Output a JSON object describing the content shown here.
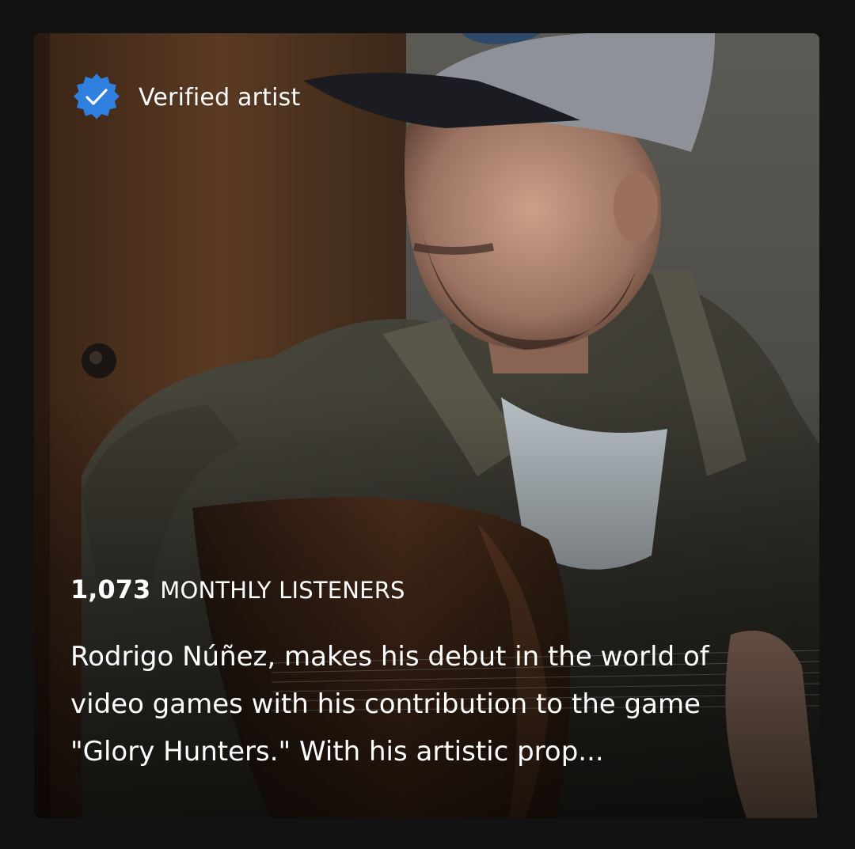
{
  "badge": {
    "icon": "verified-check-icon",
    "label": "Verified artist",
    "color": "#2f7fde"
  },
  "stats": {
    "count": "1,073",
    "unit": "MONTHLY LISTENERS"
  },
  "bio": {
    "text": "Rodrigo Núñez, makes his debut in the world of video games with his contribution to the game \"Glory Hunters.\" With his artistic prop..."
  },
  "image": {
    "description_icon": "artist-photo"
  }
}
